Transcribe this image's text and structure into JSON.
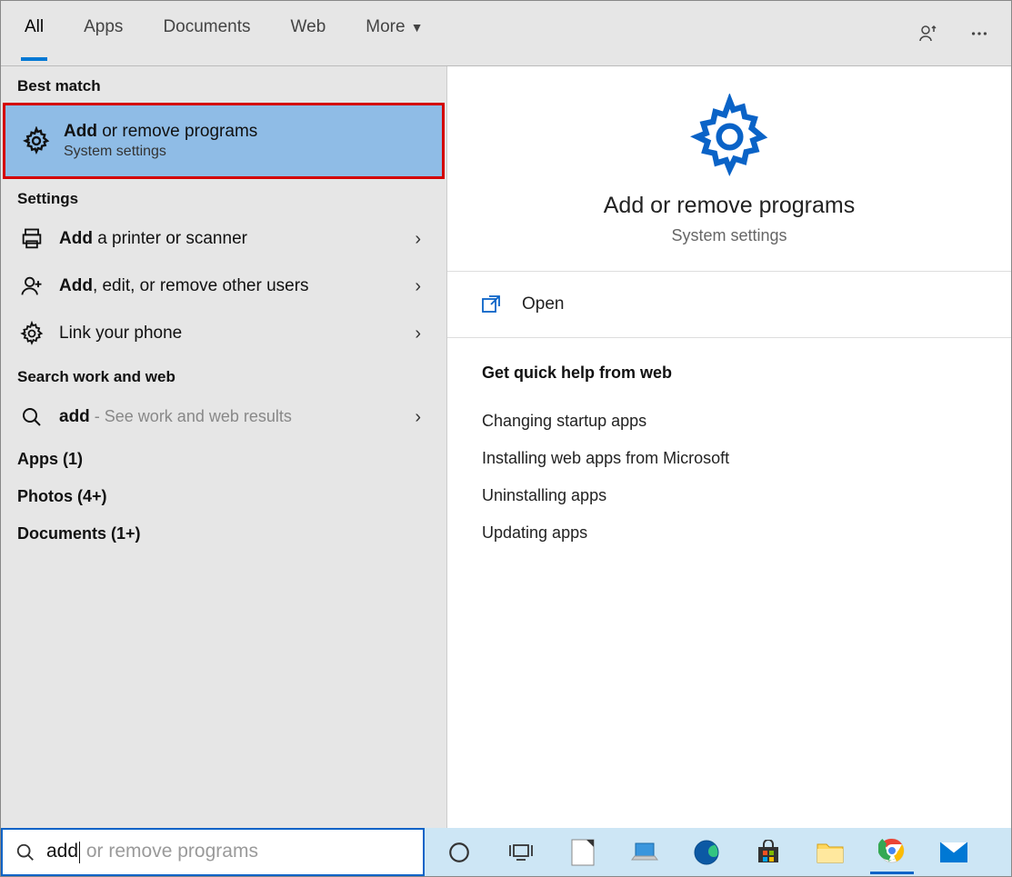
{
  "tabs": {
    "all": "All",
    "apps": "Apps",
    "documents": "Documents",
    "web": "Web",
    "more": "More"
  },
  "sections": {
    "best_match": "Best match",
    "settings": "Settings",
    "search_work_web": "Search work and web"
  },
  "best_match": {
    "title_bold": "Add",
    "title_rest": " or remove programs",
    "subtitle": "System settings"
  },
  "settings_items": [
    {
      "bold": "Add",
      "rest": " a printer or scanner"
    },
    {
      "bold": "Add",
      "rest": ", edit, or remove other users"
    },
    {
      "bold": "",
      "rest": "Link your phone"
    }
  ],
  "web_item": {
    "bold": "add",
    "hint": " - See work and web results"
  },
  "categories": {
    "apps": "Apps (1)",
    "photos": "Photos (4+)",
    "documents": "Documents (1+)"
  },
  "preview": {
    "title": "Add or remove programs",
    "subtitle": "System settings",
    "open": "Open",
    "help_head": "Get quick help from web",
    "help_links": [
      "Changing startup apps",
      "Installing web apps from Microsoft",
      "Uninstalling apps",
      "Updating apps"
    ]
  },
  "search": {
    "typed": "add",
    "ghost": " or remove programs"
  }
}
